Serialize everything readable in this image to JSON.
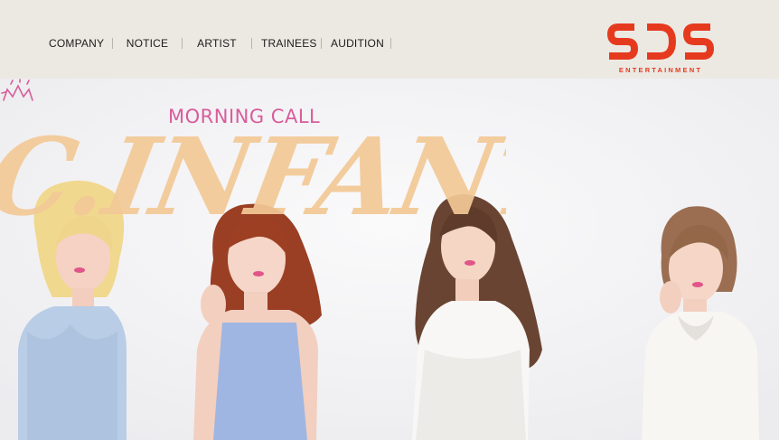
{
  "brand": {
    "name": "SDS",
    "tagline": "ENTERTAINMENT",
    "color": "#e63a1e"
  },
  "nav": {
    "items": [
      {
        "label": "COMPANY"
      },
      {
        "label": "NOTICE"
      },
      {
        "label": "ARTIST"
      },
      {
        "label": "TRAINEES"
      },
      {
        "label": "AUDITION"
      }
    ]
  },
  "hero": {
    "subtitle": "MORNING CALL",
    "title": "C.INFANTA",
    "title_color": "#f3c996",
    "subtitle_color": "#d95c9b"
  }
}
